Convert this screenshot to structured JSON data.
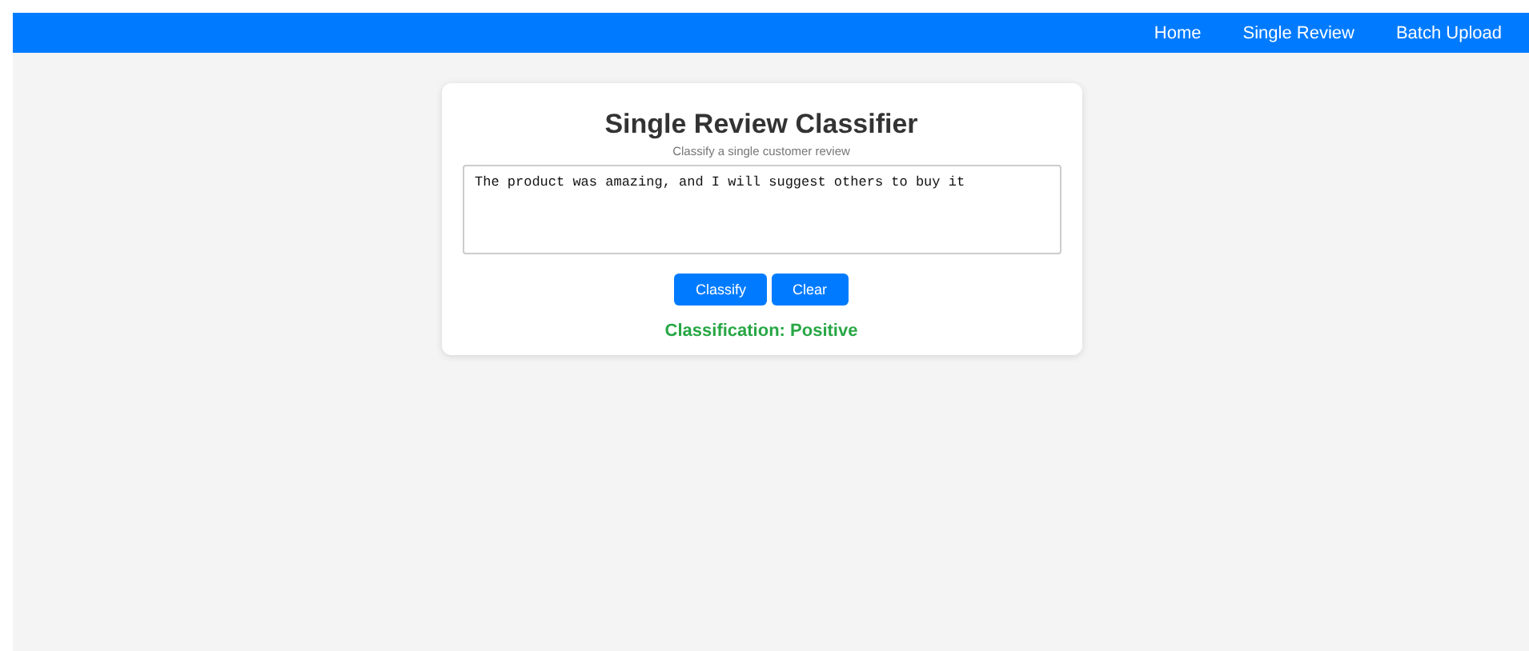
{
  "nav": {
    "links": [
      {
        "label": "Home"
      },
      {
        "label": "Single Review"
      },
      {
        "label": "Batch Upload"
      }
    ]
  },
  "card": {
    "title": "Single Review Classifier",
    "subtitle": "Classify a single customer review",
    "review": "The product was amazing, and I will suggest others to buy it",
    "buttons": [
      "Classify",
      "Clear"
    ],
    "result": {
      "text": "Classification: Positive",
      "kind": "positive"
    }
  }
}
